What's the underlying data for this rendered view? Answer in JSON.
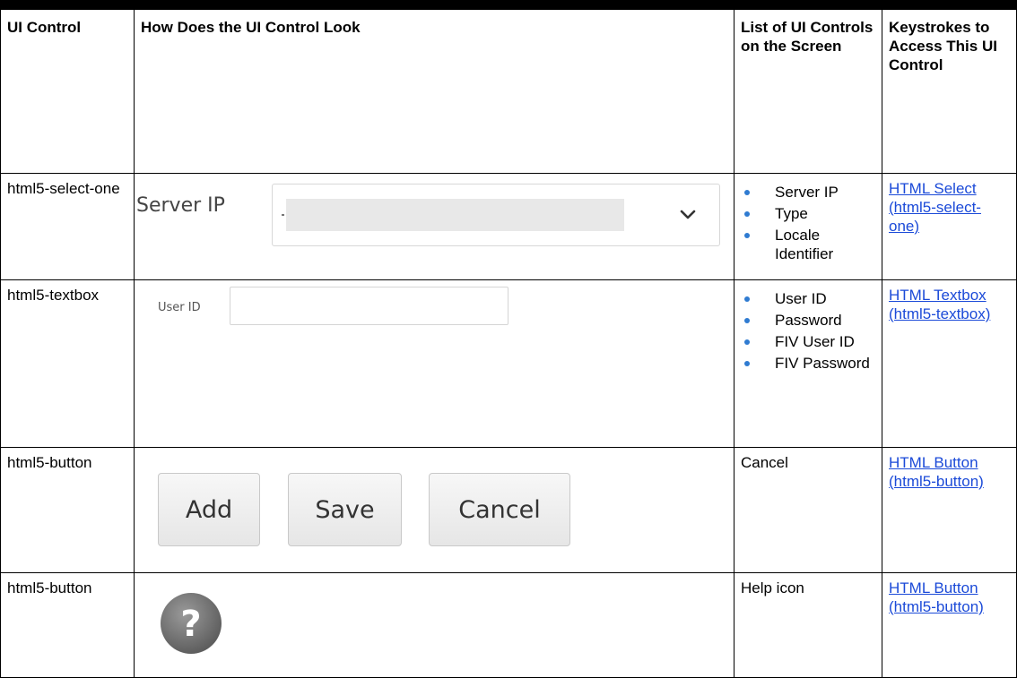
{
  "table": {
    "headers": [
      "UI Control",
      "How Does the UI Control Look",
      "List of UI Controls on the Screen",
      "Keystrokes to Access This UI Control"
    ],
    "rows": [
      {
        "control": "html5-select-one",
        "visual": {
          "kind": "select",
          "label": "Server IP",
          "icon": "chevron-down-icon"
        },
        "list": [
          "Server IP",
          "Type",
          "Locale Identifier"
        ],
        "link": "HTML Select (html5-select-one)"
      },
      {
        "control": "html5-textbox",
        "visual": {
          "kind": "textbox",
          "label": "User ID",
          "value": ""
        },
        "list": [
          "User ID",
          "Password",
          "FIV User ID",
          "FIV Password"
        ],
        "link": "HTML Textbox (html5-textbox)"
      },
      {
        "control": "html5-button",
        "visual": {
          "kind": "buttons",
          "buttons": [
            "Add",
            "Save",
            "Cancel"
          ]
        },
        "list_text": "Cancel",
        "link": "HTML Button (html5-button)"
      },
      {
        "control": "html5-button",
        "visual": {
          "kind": "icon",
          "icon": "help-icon"
        },
        "list_text": "Help icon",
        "link": "HTML Button (html5-button)"
      }
    ]
  },
  "colors": {
    "link": "#1b4ad8",
    "bullet": "#2f7bd1",
    "help_icon": "#6e6e6e"
  }
}
